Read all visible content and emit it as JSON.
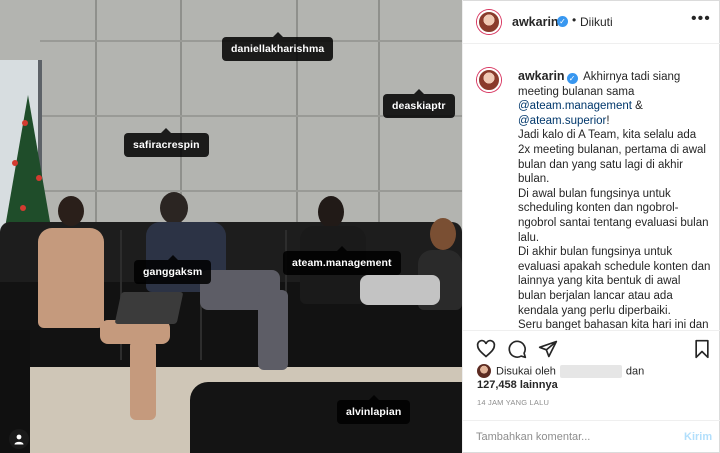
{
  "post": {
    "username": "awkarin",
    "follow_status": "Diikuti",
    "more_glyph": "•••",
    "verified_glyph": "✓"
  },
  "photo_tags": [
    {
      "label": "daniellakharishma"
    },
    {
      "label": "deaskiaptr"
    },
    {
      "label": "safiracrespin"
    },
    {
      "label": "ganggaksm"
    },
    {
      "label": "ateam.management"
    },
    {
      "label": "alvinlapian"
    }
  ],
  "caption": {
    "username": "awkarin",
    "intro": "Akhirnya tadi siang meeting bulanan sama",
    "mention_1": "@ateam.management",
    "amp": " &",
    "mention_2": "@ateam.superior",
    "after_mention": "!",
    "para_1": "Jadi kalo di A Team, kita selalu ada 2x meeting bulanan, pertama di awal bulan dan yang satu lagi di akhir bulan.",
    "para_2": "Di awal bulan fungsinya untuk scheduling konten dan ngobrol-ngobrol santai tentang evaluasi bulan lalu.",
    "para_3": "Di akhir bulan fungsinya untuk evaluasi apakah schedule konten dan lainnya yang kita bentuk di awal bulan berjalan lancar atau ada kendala yang perlu diperbaiki.",
    "para_4": "Seru banget bahasan kita hari ini dan"
  },
  "likes": {
    "prefix": "Disukai oleh",
    "suffix": "dan",
    "count": "127,458 lainnya"
  },
  "timestamp": "14 JAM YANG LALU",
  "comment": {
    "placeholder": "Tambahkan komentar...",
    "post_label": "Kirim"
  },
  "colors": {
    "link": "#00376b",
    "verified": "#3897f0",
    "post_button_disabled": "#b2dffc",
    "muted": "#8e8e8e"
  },
  "icons": [
    "heart-icon",
    "comment-icon",
    "share-icon",
    "bookmark-icon",
    "user-tag-icon",
    "more-options-icon",
    "verified-icon"
  ]
}
